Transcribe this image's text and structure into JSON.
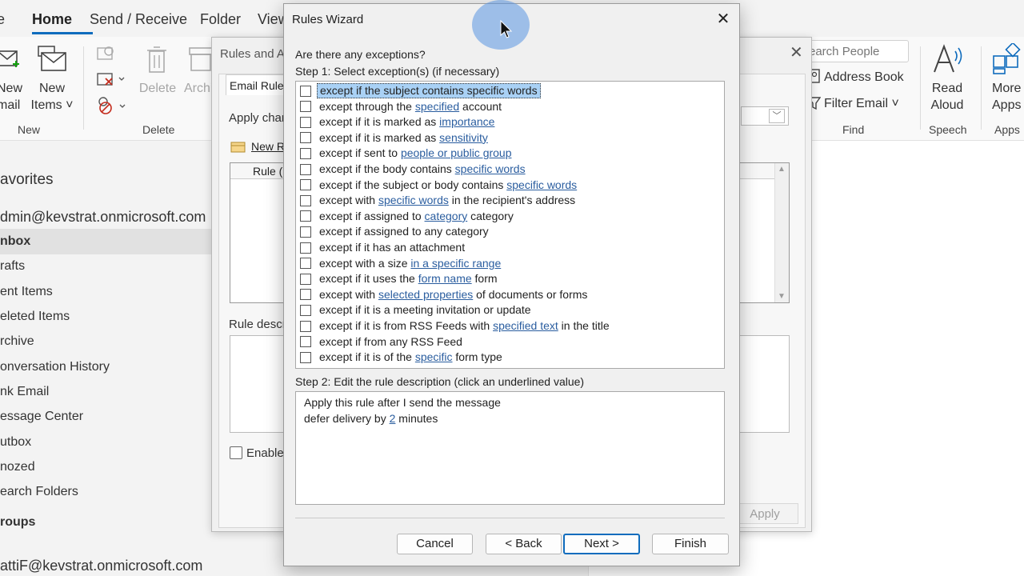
{
  "ribbon_tabs": [
    {
      "label": "e"
    },
    {
      "label": "Home"
    },
    {
      "label": "Send / Receive"
    },
    {
      "label": "Folder"
    },
    {
      "label": "View"
    }
  ],
  "ribbon": {
    "new_email": "New\nmail",
    "new_items": "New\nItems ˅",
    "group_new": "New",
    "delete": "Delete",
    "archive": "Archi",
    "group_delete": "Delete",
    "search_people_placeholder": "earch People",
    "address_book": "Address Book",
    "filter_email": "Filter Email ˅",
    "group_find": "Find",
    "read_aloud": "Read\nAloud",
    "group_speech": "Speech",
    "more_apps": "More\nApps",
    "group_apps": "Apps"
  },
  "folders": {
    "favorites": "avorites",
    "account": "dmin@kevstrat.onmicrosoft.com",
    "items": [
      "nbox",
      "rafts",
      "ent Items",
      "eleted Items",
      "rchive",
      "onversation History",
      "nk Email",
      "essage Center",
      "utbox",
      "nozed",
      "earch Folders"
    ],
    "groups": "roups",
    "account2": "attiF@kevstrat.onmicrosoft.com"
  },
  "rules_alerts": {
    "title": "Rules and A",
    "tab": "Email Rules",
    "apply_changes": "Apply char",
    "new_rule": "New R",
    "col_rule": "Rule (a",
    "rule_desc": "Rule descr",
    "enable": "Enable",
    "apply": "Apply"
  },
  "wizard": {
    "title": "Rules Wizard",
    "question": "Are there any exceptions?",
    "step1": "Step 1: Select exception(s) (if necessary)",
    "conditions": [
      {
        "a": "except if the subject contains specific words",
        "link": "",
        "b": ""
      },
      {
        "a": "except through the ",
        "link": "specified",
        "b": " account"
      },
      {
        "a": "except if it is marked as ",
        "link": "importance",
        "b": ""
      },
      {
        "a": "except if it is marked as ",
        "link": "sensitivity",
        "b": ""
      },
      {
        "a": "except if sent to ",
        "link": "people or public group",
        "b": ""
      },
      {
        "a": "except if the body contains ",
        "link": "specific words",
        "b": ""
      },
      {
        "a": "except if the subject or body contains ",
        "link": "specific words",
        "b": ""
      },
      {
        "a": "except with ",
        "link": "specific words",
        "b": " in the recipient's address"
      },
      {
        "a": "except if assigned to ",
        "link": "category",
        "b": " category"
      },
      {
        "a": "except if assigned to any category",
        "link": "",
        "b": ""
      },
      {
        "a": "except if it has an attachment",
        "link": "",
        "b": ""
      },
      {
        "a": "except with a size ",
        "link": "in a specific range",
        "b": ""
      },
      {
        "a": "except if it uses the ",
        "link": "form name",
        "b": " form"
      },
      {
        "a": "except with ",
        "link": "selected properties",
        "b": " of documents or forms"
      },
      {
        "a": "except if it is a meeting invitation or update",
        "link": "",
        "b": ""
      },
      {
        "a": "except if it is from RSS Feeds with ",
        "link": "specified text",
        "b": " in the title"
      },
      {
        "a": "except if from any RSS Feed",
        "link": "",
        "b": ""
      },
      {
        "a": "except if it is of the ",
        "link": "specific",
        "b": " form type"
      }
    ],
    "step2": "Step 2: Edit the rule description (click an underlined value)",
    "desc_line1": "Apply this rule after I send the message",
    "desc_line2_a": "defer delivery by ",
    "desc_line2_link": "2",
    "desc_line2_b": " minutes",
    "buttons": {
      "cancel": "Cancel",
      "back": "< Back",
      "next": "Next >",
      "finish": "Finish"
    }
  }
}
